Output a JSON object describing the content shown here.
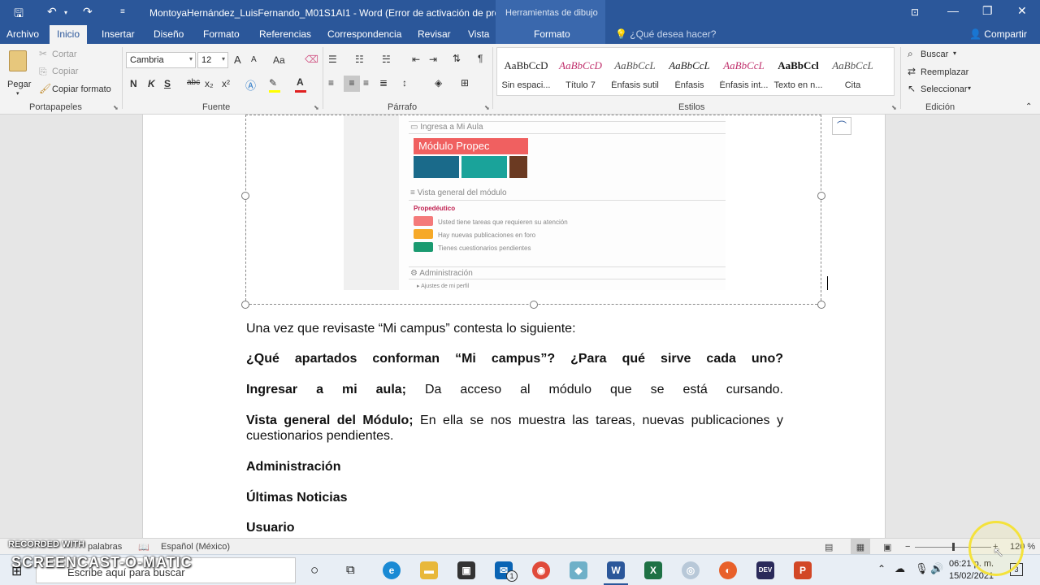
{
  "window": {
    "title": "MontoyaHernández_LuisFernando_M01S1AI1 - Word (Error de activación de produc...",
    "context_tools": "Herramientas de dibujo"
  },
  "tabs": [
    "Archivo",
    "Inicio",
    "Insertar",
    "Diseño",
    "Formato",
    "Referencias",
    "Correspondencia",
    "Revisar",
    "Vista"
  ],
  "context_tab": "Formato",
  "tell_me": "¿Qué desea hacer?",
  "share": "Compartir",
  "ribbon": {
    "clipboard": {
      "paste": "Pegar",
      "cut": "Cortar",
      "copy": "Copiar",
      "format_painter": "Copiar formato",
      "label": "Portapapeles"
    },
    "font": {
      "name": "Cambria",
      "size": "12",
      "bold": "N",
      "italic": "K",
      "underline": "S",
      "strike": "abc",
      "sub": "x₂",
      "sup": "x²",
      "grow": "A",
      "shrink": "A",
      "case": "Aa",
      "label": "Fuente"
    },
    "paragraph": {
      "label": "Párrafo",
      "pilcrow": "¶"
    },
    "styles": {
      "label": "Estilos",
      "items": [
        {
          "preview": "AaBbCcD",
          "name": "Sin espaci...",
          "color": "#222222"
        },
        {
          "preview": "AaBbCcD",
          "name": "Título 7",
          "color": "#c0306c"
        },
        {
          "preview": "AaBbCcL",
          "name": "Énfasis sutil",
          "color": "#555555"
        },
        {
          "preview": "AaBbCcL",
          "name": "Énfasis",
          "color": "#222222"
        },
        {
          "preview": "AaBbCcL",
          "name": "Énfasis int...",
          "color": "#c0306c"
        },
        {
          "preview": "AaBbCcl",
          "name": "Texto en n...",
          "color": "#111111"
        },
        {
          "preview": "AaBbCcL",
          "name": "Cita",
          "color": "#555555"
        }
      ]
    },
    "editing": {
      "find": "Buscar",
      "replace": "Reemplazar",
      "select": "Seleccionar",
      "label": "Edición"
    }
  },
  "embedded_screenshot": {
    "heading1": "Ingresa a Mi Aula",
    "banner": "Módulo Propec",
    "heading2": "Vista general del módulo",
    "course": "Propedéutico",
    "items": [
      "Usted tiene tareas que requieren su atención",
      "Hay nuevas publicaciones en foro",
      "Tienes cuestionarios pendientes"
    ],
    "heading3": "Administración",
    "sub_item": "Ajustes de mi perfil"
  },
  "document": {
    "p1": "Una vez que revisaste “Mi campus” contesta lo siguiente:",
    "p2": "¿Qué apartados conforman “Mi campus”? ¿Para qué sirve cada uno?",
    "p3_bold": "Ingresar a mi aula;",
    "p3_text": " Da acceso al módulo que se está cursando.",
    "p4_bold": "Vista general del Módulo;",
    "p4_text": " En ella se nos muestra las tareas, nuevas publicaciones y cuestionarios pendientes.",
    "p5": "Administración",
    "p6": "Últimas Noticias",
    "p7": "Usuario"
  },
  "statusbar": {
    "words": "palabras",
    "language": "Español (México)",
    "zoom": "120 %"
  },
  "taskbar": {
    "search_placeholder": "Escribe aquí para buscar",
    "time": "06:21 p. m.",
    "date": "15/02/2021",
    "notifications": "3"
  },
  "watermark": {
    "line1": "RECORDED WITH",
    "line2": "SCREENCAST-O-MATIC"
  }
}
